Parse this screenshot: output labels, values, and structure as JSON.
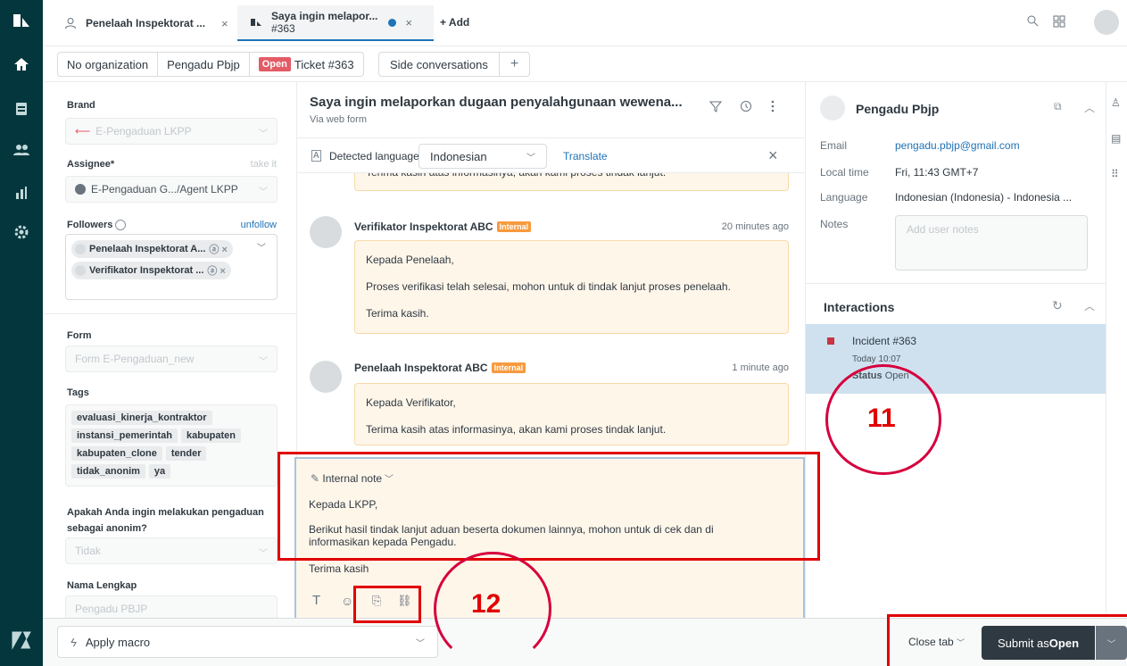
{
  "tabs": [
    {
      "title": "Penelaah Inspektorat ...",
      "close": "×"
    },
    {
      "title": "Saya ingin melapor...",
      "subtitle": "#363",
      "close": "×"
    }
  ],
  "add_tab_label": "+ Add",
  "crumbs": {
    "organization": "No organization",
    "requester": "Pengadu Pbjp",
    "status_badge": "Open",
    "ticket": "Ticket #363"
  },
  "side_conversations_label": "Side conversations",
  "side_conversations_plus": "+",
  "left": {
    "brand_label": "Brand",
    "brand_value": "E-Pengaduan LKPP",
    "assignee_label": "Assignee*",
    "assignee_take": "take it",
    "assignee_value": "E-Pengaduan G.../Agent LKPP",
    "followers_label": "Followers",
    "followers_unfollow": "unfollow",
    "followers": [
      "Penelaah Inspektorat A...",
      "Verifikator Inspektorat ..."
    ],
    "form_label": "Form",
    "form_value": "Form E-Pengaduan_new",
    "tags_label": "Tags",
    "tags": [
      "evaluasi_kinerja_kontraktor",
      "instansi_pemerintah",
      "kabupaten",
      "kabupaten_clone",
      "tender",
      "tidak_anonim",
      "ya"
    ],
    "anon_label": "Apakah Anda ingin melakukan pengaduan sebagai anonim?",
    "anon_value": "Tidak",
    "name_label": "Nama Lengkap",
    "name_value": "Pengadu PBJP"
  },
  "center": {
    "subject": "Saya ingin melaporkan dugaan penyalahgunaan wewena...",
    "via": "Via web form",
    "detected_language_label": "Detected language",
    "language_value": "Indonesian",
    "translate_label": "Translate",
    "partial_msg": "Terima kasih atas informasinya, akan kami proses tindak lanjut.",
    "messages": [
      {
        "author": "Verifikator Inspektorat ABC",
        "badge": "Internal",
        "time": "20 minutes ago",
        "lines": [
          "Kepada Penelaah,",
          "Proses verifikasi telah selesai, mohon untuk di tindak lanjut proses penelaah.",
          "Terima kasih."
        ]
      },
      {
        "author": "Penelaah Inspektorat ABC",
        "badge": "Internal",
        "time": "1 minute ago",
        "lines": [
          "Kepada Verifikator,",
          "Terima kasih atas informasinya, akan kami proses tindak lanjut."
        ]
      }
    ],
    "composer": {
      "mode": "Internal note",
      "line1": "Kepada LKPP,",
      "line2": "Berikut hasil tindak lanjut aduan beserta dokumen lainnya, mohon untuk di cek dan di",
      "line3": "informasikan kepada Pengadu.",
      "line4": "Terima kasih"
    }
  },
  "right": {
    "name": "Pengadu Pbjp",
    "email_label": "Email",
    "email_value": "pengadu.pbjp@gmail.com",
    "localtime_label": "Local time",
    "localtime_value": "Fri, 11:43 GMT+7",
    "language_label": "Language",
    "language_value": "Indonesian (Indonesia) - Indonesia ...",
    "notes_label": "Notes",
    "notes_placeholder": "Add user notes",
    "interactions_title": "Interactions",
    "incident_title": "Incident #363",
    "incident_time": "Today 10:07",
    "incident_status_label": "Status",
    "incident_status_value": "Open"
  },
  "bottom": {
    "macro_label": "Apply macro",
    "close_tab_label": "Close tab",
    "submit_prefix": "Submit as ",
    "submit_status": "Open"
  },
  "annotations": {
    "num11": "11",
    "num12": "12"
  },
  "colors": {
    "nav": "#03363d",
    "open_badge": "#e35b66",
    "internal": "#f79a3e",
    "highlight": "#e00000",
    "incident_bg": "#cfe1ef"
  }
}
